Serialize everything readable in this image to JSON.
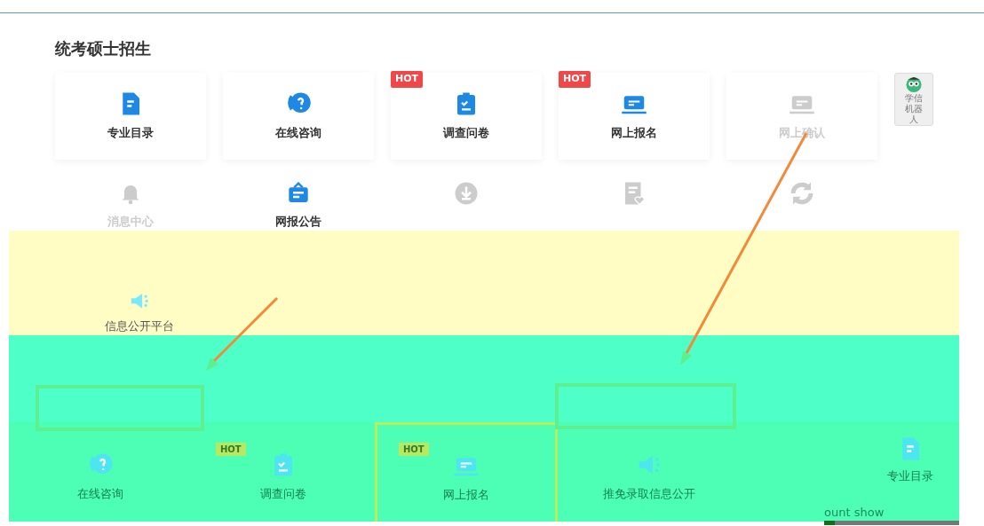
{
  "title": "统考硕士招生",
  "cards": [
    {
      "label": "专业目录",
      "kind": "document",
      "disabled": false
    },
    {
      "label": "在线咨询",
      "kind": "chat",
      "disabled": false
    },
    {
      "label": "调查问卷",
      "kind": "clipboard",
      "hot_label": "HOT",
      "disabled": false
    },
    {
      "label": "网上报名",
      "kind": "laptop",
      "hot_label": "HOT",
      "disabled": false
    },
    {
      "label": "网上确认",
      "kind": "laptop",
      "disabled": true
    }
  ],
  "robot": {
    "label": "学信机器人"
  },
  "row2": [
    {
      "label": "消息中心",
      "kind": "bell",
      "disabled": true
    },
    {
      "label": "网报公告",
      "kind": "board",
      "disabled": false
    },
    {
      "kind": "download",
      "disabled": true
    },
    {
      "kind": "doc-heart",
      "disabled": true
    },
    {
      "kind": "refresh",
      "disabled": true
    }
  ],
  "row3": [
    {
      "label": "信息公开平台",
      "kind": "speaker"
    }
  ],
  "bottom_nav": [
    {
      "label": "在线咨询",
      "kind": "chat",
      "selected": false
    },
    {
      "label": "调查问卷",
      "kind": "clipboard",
      "hot_label": "HOT",
      "selected": false
    },
    {
      "label": "网上报名",
      "kind": "laptop",
      "hot_label": "HOT",
      "selected": true
    },
    {
      "label": "推免录取信息公开",
      "kind": "speaker",
      "selected": false
    },
    {
      "label": "专业目录",
      "kind": "document",
      "selected": false
    }
  ],
  "footer_text": "ount show",
  "progress": {
    "level": 0.08
  }
}
